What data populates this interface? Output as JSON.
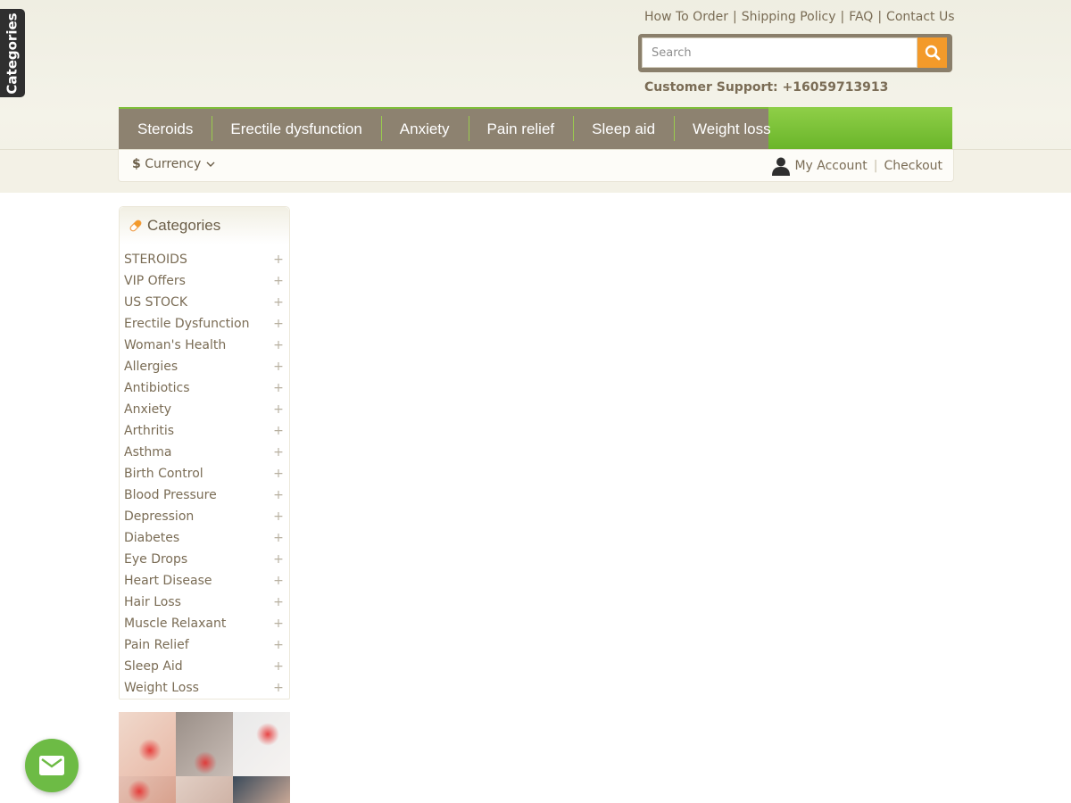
{
  "side_tab": {
    "label": "Categories"
  },
  "top_links": [
    "How To Order",
    "Shipping Policy",
    "FAQ",
    "Contact Us"
  ],
  "search": {
    "placeholder": "Search",
    "button_icon": "search-icon"
  },
  "support": {
    "text": "Customer Support: +16059713913"
  },
  "main_nav": [
    "Steroids",
    "Erectile dysfunction",
    "Anxiety",
    "Pain relief",
    "Sleep aid",
    "Weight loss"
  ],
  "sub_bar": {
    "currency_symbol": "$",
    "currency_label": "Currency",
    "my_account": "My Account",
    "checkout": "Checkout"
  },
  "categories": {
    "title": "Categories",
    "items": [
      "STEROIDS",
      "VIP Offers",
      "US STOCK",
      "Erectile Dysfunction",
      "Woman's Health",
      "Allergies",
      "Antibiotics",
      "Anxiety",
      "Arthritis",
      "Asthma",
      "Birth Control",
      "Blood Pressure",
      "Depression",
      "Diabetes",
      "Eye Drops",
      "Heart Disease",
      "Hair Loss",
      "Muscle Relaxant",
      "Pain Relief",
      "Sleep Aid",
      "Weight Loss"
    ],
    "expand_glyph": "+"
  },
  "colors": {
    "nav_bg": "#8d8270",
    "nav_accent": "#7fbe3a",
    "search_button": "#f39a2a",
    "mail_fab": "#6dbb45"
  }
}
